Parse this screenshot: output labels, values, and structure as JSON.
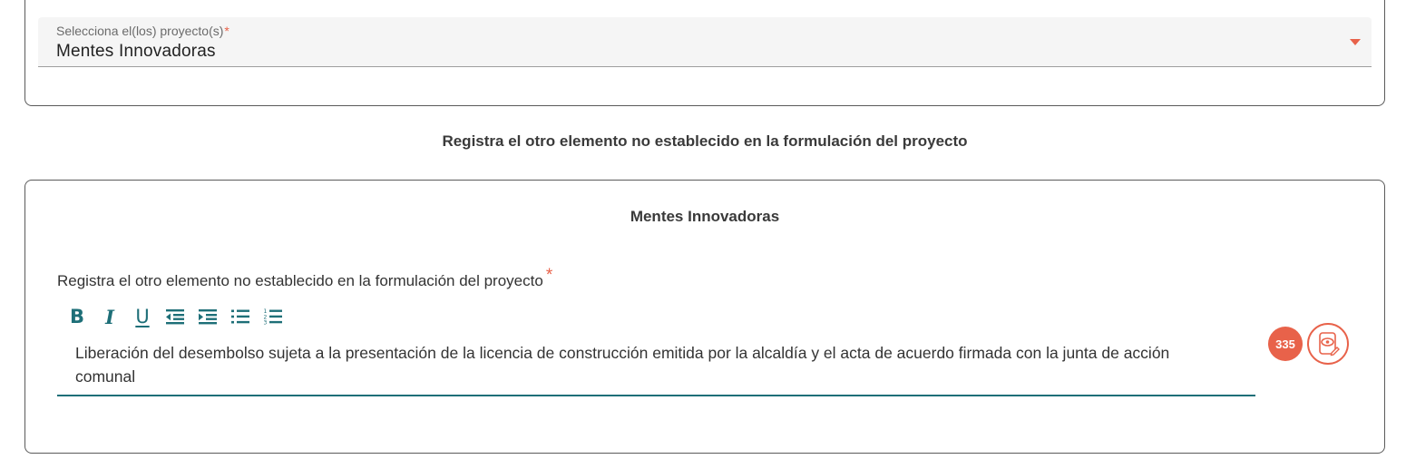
{
  "project_selector": {
    "label": "Selecciona el(los) proyecto(s)",
    "required_mark": "*",
    "value": "Mentes Innovadoras",
    "icon": "caret-down-icon",
    "accent_color": "#e8624a"
  },
  "section": {
    "heading": "Registra el otro elemento no establecido en la formulación del proyecto"
  },
  "project_card": {
    "title": "Mentes Innovadoras",
    "field_label": "Registra el otro elemento no establecido en la formulación del proyecto",
    "required_mark": "*",
    "toolbar": {
      "bold": "B",
      "italic": "I",
      "underline": "U",
      "icons": [
        "bold-icon",
        "italic-icon",
        "underline-icon",
        "outdent-icon",
        "indent-icon",
        "bullet-list-icon",
        "numbered-list-icon"
      ]
    },
    "editor_text": "Liberación del desembolso sujeta a la presentación de la licencia de construcción emitida por la alcaldía y el acta de acuerdo firmada con la junta de acción comunal",
    "char_count": "335",
    "preview_icon": "preview-document-icon",
    "editor_accent_color": "#1e6f78"
  }
}
